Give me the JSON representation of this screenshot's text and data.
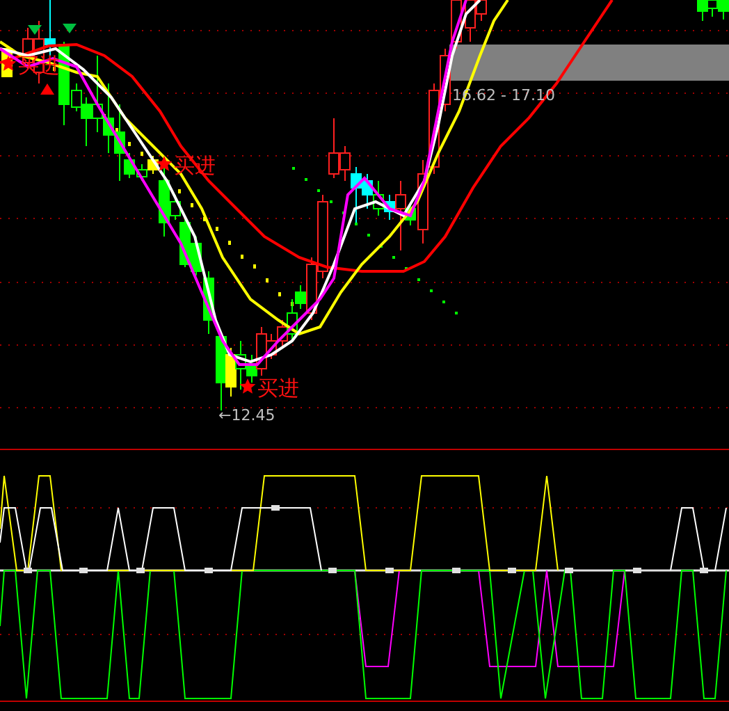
{
  "signals": [
    {
      "label": "买进",
      "kind": "buy"
    },
    {
      "label": "买进",
      "kind": "buy"
    },
    {
      "label": "买进",
      "kind": "buy"
    }
  ],
  "low_label": "←12.45",
  "range_label": "16.62 - 17.10"
}
